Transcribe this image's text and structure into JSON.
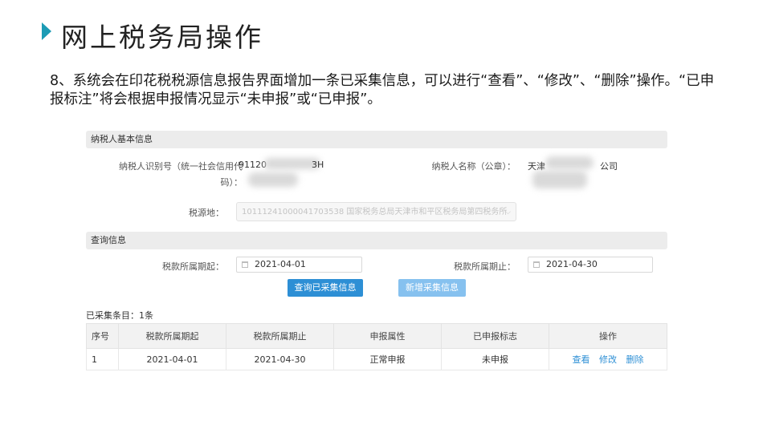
{
  "slide": {
    "title": "网上税务局操作",
    "description": "8、系统会在印花税税源信息报告界面增加一条已采集信息，可以进行“查看”、“修改”、“删除”操作。“已申报标注”将会根据申报情况显示“未申报”或“已申报”。"
  },
  "basic_info": {
    "section_title": "纳税人基本信息",
    "taxpayer_id_label_1": "纳税人识别号（统一社会信用代",
    "taxpayer_id_label_2": "码）：",
    "taxpayer_id_value_prefix": "91120",
    "taxpayer_id_value_suffix": "3H",
    "taxpayer_name_label": "纳税人名称（公章）：",
    "taxpayer_name_prefix": "天津",
    "taxpayer_name_suffix": "公司",
    "tax_source_label": "税源地：",
    "tax_source_value": "10111241000041703538 国家税务总局天津市和平区税务局第四税务所"
  },
  "query": {
    "section_title": "查询信息",
    "start_label": "税款所属期起：",
    "start_value": "2021-04-01",
    "end_label": "税款所属期止：",
    "end_value": "2021-04-30",
    "query_button": "查询已采集信息",
    "new_button": "新增采集信息"
  },
  "records": {
    "count_text": "已采集条目：1条",
    "columns": [
      "序号",
      "税款所属期起",
      "税款所属期止",
      "申报属性",
      "已申报标志",
      "操作"
    ],
    "rows": [
      {
        "index": "1",
        "start": "2021-04-01",
        "end": "2021-04-30",
        "attribute": "正常申报",
        "status": "未申报",
        "actions": [
          "查看",
          "修改",
          "删除"
        ]
      }
    ]
  },
  "colors": {
    "accent": "#1c9bb5",
    "primary_button": "#2d8fd5",
    "secondary_button": "#86c1ef",
    "status_unreported": "#e8a33c"
  },
  "icons": [
    "title-arrow-icon",
    "calendar-icon",
    "chevron-down-icon"
  ]
}
